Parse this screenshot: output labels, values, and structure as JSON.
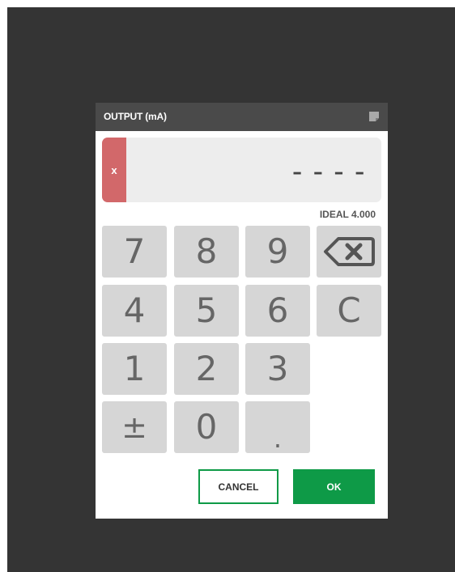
{
  "dialog": {
    "title": "OUTPUT (mA)",
    "clear_label": "x",
    "display_value": "----",
    "ideal_text": "IDEAL 4.000"
  },
  "keypad": {
    "k7": "7",
    "k8": "8",
    "k9": "9",
    "k4": "4",
    "k5": "5",
    "k6": "6",
    "kC": "C",
    "k1": "1",
    "k2": "2",
    "k3": "3",
    "kpm": "±",
    "k0": "0",
    "kdot": "."
  },
  "buttons": {
    "cancel": "CANCEL",
    "ok": "OK"
  },
  "colors": {
    "background": "#343434",
    "header": "#4a4a4a",
    "accent_green": "#0e9a47",
    "clear_red": "#d2686a",
    "key_gray": "#d6d6d6"
  },
  "icons": {
    "header": "note-icon",
    "backspace": "backspace-icon"
  }
}
